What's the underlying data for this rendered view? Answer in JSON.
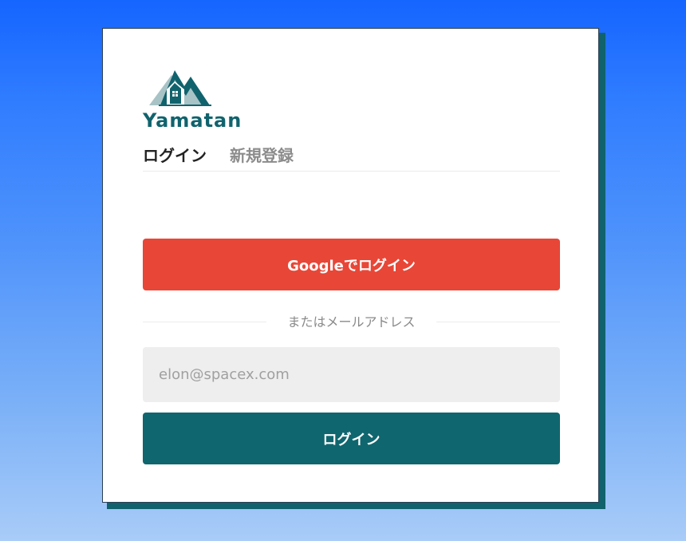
{
  "brand": {
    "name": "Yamatan",
    "logo_icon": "mountain-house-icon",
    "color": "#10636d"
  },
  "tabs": {
    "login": "ログイン",
    "register": "新規登録"
  },
  "google_button": {
    "label": "Googleでログイン",
    "color": "#e84637"
  },
  "divider": {
    "text": "またはメールアドレス"
  },
  "email": {
    "value": "",
    "placeholder": "elon@spacex.com"
  },
  "login_button": {
    "label": "ログイン",
    "color": "#10666f"
  }
}
